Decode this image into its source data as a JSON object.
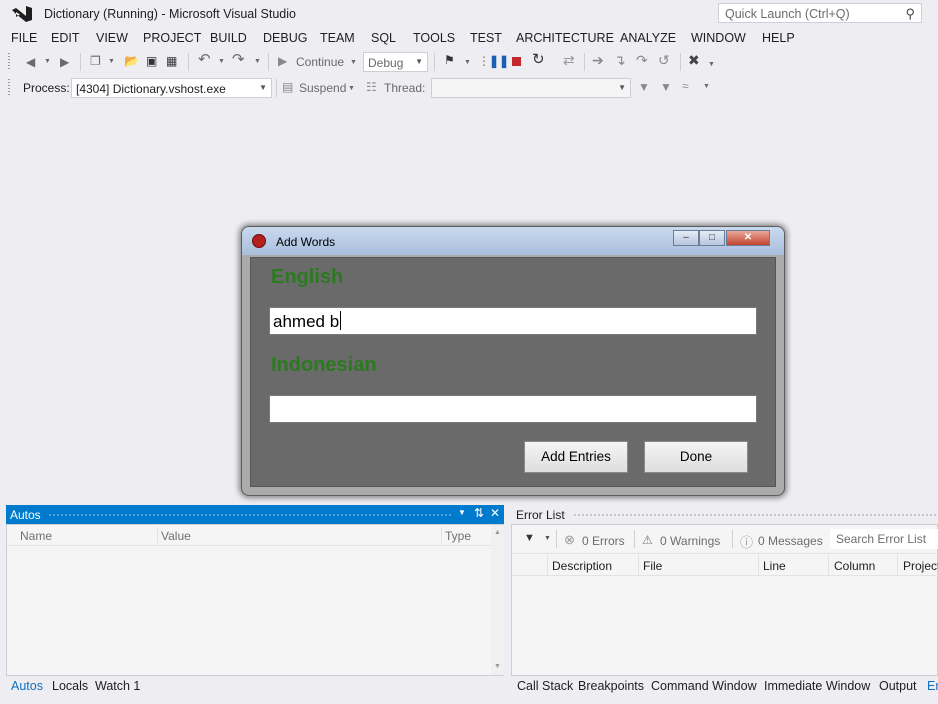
{
  "window": {
    "title": "Dictionary (Running) - Microsoft Visual Studio"
  },
  "quick_launch": {
    "placeholder": "Quick Launch (Ctrl+Q)"
  },
  "menu": [
    "FILE",
    "EDIT",
    "VIEW",
    "PROJECT",
    "BUILD",
    "DEBUG",
    "TEAM",
    "SQL",
    "TOOLS",
    "TEST",
    "ARCHITECTURE",
    "ANALYZE",
    "WINDOW",
    "HELP"
  ],
  "toolbar": {
    "continue_label": "Continue",
    "config_value": "Debug",
    "process_label": "Process:",
    "process_value": "[4304] Dictionary.vshost.exe",
    "suspend_label": "Suspend",
    "thread_label": "Thread:"
  },
  "dialog": {
    "title": "Add Words",
    "english_label": "English",
    "english_value": "ahmed b",
    "indonesian_label": "Indonesian",
    "indonesian_value": "",
    "add_button": "Add Entries",
    "done_button": "Done"
  },
  "autos": {
    "title": "Autos",
    "columns": [
      "Name",
      "Value",
      "Type"
    ],
    "tabs": [
      "Autos",
      "Locals",
      "Watch 1"
    ]
  },
  "error_list": {
    "title": "Error List",
    "errors": "0 Errors",
    "warnings": "0 Warnings",
    "messages": "0 Messages",
    "search_placeholder": "Search Error List",
    "columns": [
      "Description",
      "File",
      "Line",
      "Column",
      "Project"
    ],
    "tabs": [
      "Call Stack",
      "Breakpoints",
      "Command Window",
      "Immediate Window",
      "Output",
      "Error List"
    ]
  },
  "colors": {
    "accent": "#007acc",
    "label_green": "#2b7a1f",
    "dialog_bg": "#6a6a6a"
  }
}
